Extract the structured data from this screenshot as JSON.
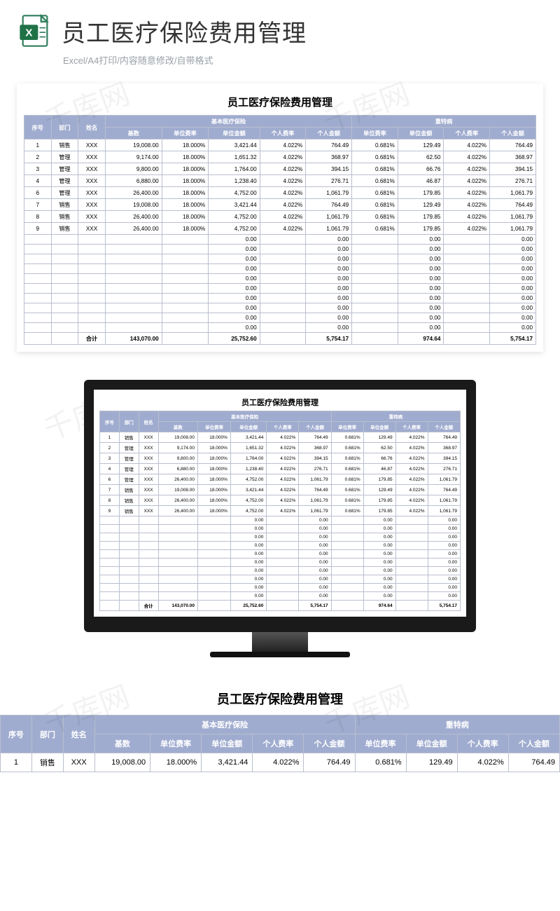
{
  "hero": {
    "title": "员工医疗保险费用管理",
    "subtitle": "Excel/A4打印/内容随意修改/自带格式",
    "icon_name": "excel-file-icon"
  },
  "sheet": {
    "title": "员工医疗保险费用管理",
    "group1": "基本医疗保险",
    "group2": "重特病",
    "cols": {
      "seq": "序号",
      "dept": "部门",
      "name": "姓名",
      "base": "基数",
      "urate": "单位费率",
      "uamt": "单位金额",
      "prate": "个人费率",
      "pamt": "个人金额",
      "urate2": "单位费率",
      "uamt2": "单位金额",
      "prate2": "个人费率",
      "pamt2": "个人金额"
    },
    "rows": [
      {
        "seq": "1",
        "dept": "销售",
        "name": "XXX",
        "base": "19,008.00",
        "urate": "18.000%",
        "uamt": "3,421.44",
        "prate": "4.022%",
        "pamt": "764.49",
        "urate2": "0.681%",
        "uamt2": "129.49",
        "prate2": "4.022%",
        "pamt2": "764.49"
      },
      {
        "seq": "2",
        "dept": "管理",
        "name": "XXX",
        "base": "9,174.00",
        "urate": "18.000%",
        "uamt": "1,651.32",
        "prate": "4.022%",
        "pamt": "368.97",
        "urate2": "0.681%",
        "uamt2": "62.50",
        "prate2": "4.022%",
        "pamt2": "368.97"
      },
      {
        "seq": "3",
        "dept": "管理",
        "name": "XXX",
        "base": "9,800.00",
        "urate": "18.000%",
        "uamt": "1,764.00",
        "prate": "4.022%",
        "pamt": "394.15",
        "urate2": "0.681%",
        "uamt2": "66.76",
        "prate2": "4.022%",
        "pamt2": "394.15"
      },
      {
        "seq": "4",
        "dept": "管理",
        "name": "XXX",
        "base": "6,880.00",
        "urate": "18.000%",
        "uamt": "1,238.40",
        "prate": "4.022%",
        "pamt": "276.71",
        "urate2": "0.681%",
        "uamt2": "46.87",
        "prate2": "4.022%",
        "pamt2": "276.71"
      },
      {
        "seq": "6",
        "dept": "管理",
        "name": "XXX",
        "base": "26,400.00",
        "urate": "18.000%",
        "uamt": "4,752.00",
        "prate": "4.022%",
        "pamt": "1,061.79",
        "urate2": "0.681%",
        "uamt2": "179.85",
        "prate2": "4.022%",
        "pamt2": "1,061.79"
      },
      {
        "seq": "7",
        "dept": "销售",
        "name": "XXX",
        "base": "19,008.00",
        "urate": "18.000%",
        "uamt": "3,421.44",
        "prate": "4.022%",
        "pamt": "764.49",
        "urate2": "0.681%",
        "uamt2": "129.49",
        "prate2": "4.022%",
        "pamt2": "764.49"
      },
      {
        "seq": "8",
        "dept": "销售",
        "name": "XXX",
        "base": "26,400.00",
        "urate": "18.000%",
        "uamt": "4,752.00",
        "prate": "4.022%",
        "pamt": "1,061.79",
        "urate2": "0.681%",
        "uamt2": "179.85",
        "prate2": "4.022%",
        "pamt2": "1,061.79"
      },
      {
        "seq": "9",
        "dept": "销售",
        "name": "XXX",
        "base": "26,400.00",
        "urate": "18.000%",
        "uamt": "4,752.00",
        "prate": "4.022%",
        "pamt": "1,061.79",
        "urate2": "0.681%",
        "uamt2": "179.85",
        "prate2": "4.022%",
        "pamt2": "1,061.79"
      }
    ],
    "empty_rows": 10,
    "zero": "0.00",
    "total_label": "合计",
    "totals": {
      "base": "143,070.00",
      "uamt": "25,752.60",
      "pamt": "5,754.17",
      "uamt2": "974.64",
      "pamt2": "5,754.17"
    }
  },
  "watermark": "千库网"
}
